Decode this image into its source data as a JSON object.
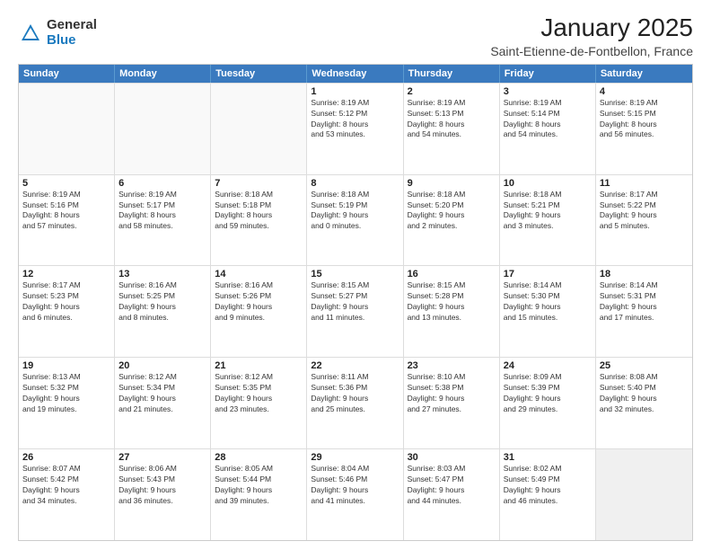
{
  "logo": {
    "general": "General",
    "blue": "Blue"
  },
  "header": {
    "title": "January 2025",
    "subtitle": "Saint-Etienne-de-Fontbellon, France"
  },
  "weekdays": [
    "Sunday",
    "Monday",
    "Tuesday",
    "Wednesday",
    "Thursday",
    "Friday",
    "Saturday"
  ],
  "rows": [
    [
      {
        "day": "",
        "lines": [],
        "empty": true
      },
      {
        "day": "",
        "lines": [],
        "empty": true
      },
      {
        "day": "",
        "lines": [],
        "empty": true
      },
      {
        "day": "1",
        "lines": [
          "Sunrise: 8:19 AM",
          "Sunset: 5:12 PM",
          "Daylight: 8 hours",
          "and 53 minutes."
        ]
      },
      {
        "day": "2",
        "lines": [
          "Sunrise: 8:19 AM",
          "Sunset: 5:13 PM",
          "Daylight: 8 hours",
          "and 54 minutes."
        ]
      },
      {
        "day": "3",
        "lines": [
          "Sunrise: 8:19 AM",
          "Sunset: 5:14 PM",
          "Daylight: 8 hours",
          "and 54 minutes."
        ]
      },
      {
        "day": "4",
        "lines": [
          "Sunrise: 8:19 AM",
          "Sunset: 5:15 PM",
          "Daylight: 8 hours",
          "and 56 minutes."
        ]
      }
    ],
    [
      {
        "day": "5",
        "lines": [
          "Sunrise: 8:19 AM",
          "Sunset: 5:16 PM",
          "Daylight: 8 hours",
          "and 57 minutes."
        ]
      },
      {
        "day": "6",
        "lines": [
          "Sunrise: 8:19 AM",
          "Sunset: 5:17 PM",
          "Daylight: 8 hours",
          "and 58 minutes."
        ]
      },
      {
        "day": "7",
        "lines": [
          "Sunrise: 8:18 AM",
          "Sunset: 5:18 PM",
          "Daylight: 8 hours",
          "and 59 minutes."
        ]
      },
      {
        "day": "8",
        "lines": [
          "Sunrise: 8:18 AM",
          "Sunset: 5:19 PM",
          "Daylight: 9 hours",
          "and 0 minutes."
        ]
      },
      {
        "day": "9",
        "lines": [
          "Sunrise: 8:18 AM",
          "Sunset: 5:20 PM",
          "Daylight: 9 hours",
          "and 2 minutes."
        ]
      },
      {
        "day": "10",
        "lines": [
          "Sunrise: 8:18 AM",
          "Sunset: 5:21 PM",
          "Daylight: 9 hours",
          "and 3 minutes."
        ]
      },
      {
        "day": "11",
        "lines": [
          "Sunrise: 8:17 AM",
          "Sunset: 5:22 PM",
          "Daylight: 9 hours",
          "and 5 minutes."
        ]
      }
    ],
    [
      {
        "day": "12",
        "lines": [
          "Sunrise: 8:17 AM",
          "Sunset: 5:23 PM",
          "Daylight: 9 hours",
          "and 6 minutes."
        ]
      },
      {
        "day": "13",
        "lines": [
          "Sunrise: 8:16 AM",
          "Sunset: 5:25 PM",
          "Daylight: 9 hours",
          "and 8 minutes."
        ]
      },
      {
        "day": "14",
        "lines": [
          "Sunrise: 8:16 AM",
          "Sunset: 5:26 PM",
          "Daylight: 9 hours",
          "and 9 minutes."
        ]
      },
      {
        "day": "15",
        "lines": [
          "Sunrise: 8:15 AM",
          "Sunset: 5:27 PM",
          "Daylight: 9 hours",
          "and 11 minutes."
        ]
      },
      {
        "day": "16",
        "lines": [
          "Sunrise: 8:15 AM",
          "Sunset: 5:28 PM",
          "Daylight: 9 hours",
          "and 13 minutes."
        ]
      },
      {
        "day": "17",
        "lines": [
          "Sunrise: 8:14 AM",
          "Sunset: 5:30 PM",
          "Daylight: 9 hours",
          "and 15 minutes."
        ]
      },
      {
        "day": "18",
        "lines": [
          "Sunrise: 8:14 AM",
          "Sunset: 5:31 PM",
          "Daylight: 9 hours",
          "and 17 minutes."
        ]
      }
    ],
    [
      {
        "day": "19",
        "lines": [
          "Sunrise: 8:13 AM",
          "Sunset: 5:32 PM",
          "Daylight: 9 hours",
          "and 19 minutes."
        ]
      },
      {
        "day": "20",
        "lines": [
          "Sunrise: 8:12 AM",
          "Sunset: 5:34 PM",
          "Daylight: 9 hours",
          "and 21 minutes."
        ]
      },
      {
        "day": "21",
        "lines": [
          "Sunrise: 8:12 AM",
          "Sunset: 5:35 PM",
          "Daylight: 9 hours",
          "and 23 minutes."
        ]
      },
      {
        "day": "22",
        "lines": [
          "Sunrise: 8:11 AM",
          "Sunset: 5:36 PM",
          "Daylight: 9 hours",
          "and 25 minutes."
        ]
      },
      {
        "day": "23",
        "lines": [
          "Sunrise: 8:10 AM",
          "Sunset: 5:38 PM",
          "Daylight: 9 hours",
          "and 27 minutes."
        ]
      },
      {
        "day": "24",
        "lines": [
          "Sunrise: 8:09 AM",
          "Sunset: 5:39 PM",
          "Daylight: 9 hours",
          "and 29 minutes."
        ]
      },
      {
        "day": "25",
        "lines": [
          "Sunrise: 8:08 AM",
          "Sunset: 5:40 PM",
          "Daylight: 9 hours",
          "and 32 minutes."
        ]
      }
    ],
    [
      {
        "day": "26",
        "lines": [
          "Sunrise: 8:07 AM",
          "Sunset: 5:42 PM",
          "Daylight: 9 hours",
          "and 34 minutes."
        ]
      },
      {
        "day": "27",
        "lines": [
          "Sunrise: 8:06 AM",
          "Sunset: 5:43 PM",
          "Daylight: 9 hours",
          "and 36 minutes."
        ]
      },
      {
        "day": "28",
        "lines": [
          "Sunrise: 8:05 AM",
          "Sunset: 5:44 PM",
          "Daylight: 9 hours",
          "and 39 minutes."
        ]
      },
      {
        "day": "29",
        "lines": [
          "Sunrise: 8:04 AM",
          "Sunset: 5:46 PM",
          "Daylight: 9 hours",
          "and 41 minutes."
        ]
      },
      {
        "day": "30",
        "lines": [
          "Sunrise: 8:03 AM",
          "Sunset: 5:47 PM",
          "Daylight: 9 hours",
          "and 44 minutes."
        ]
      },
      {
        "day": "31",
        "lines": [
          "Sunrise: 8:02 AM",
          "Sunset: 5:49 PM",
          "Daylight: 9 hours",
          "and 46 minutes."
        ]
      },
      {
        "day": "",
        "lines": [],
        "empty": true,
        "shaded": true
      }
    ]
  ]
}
